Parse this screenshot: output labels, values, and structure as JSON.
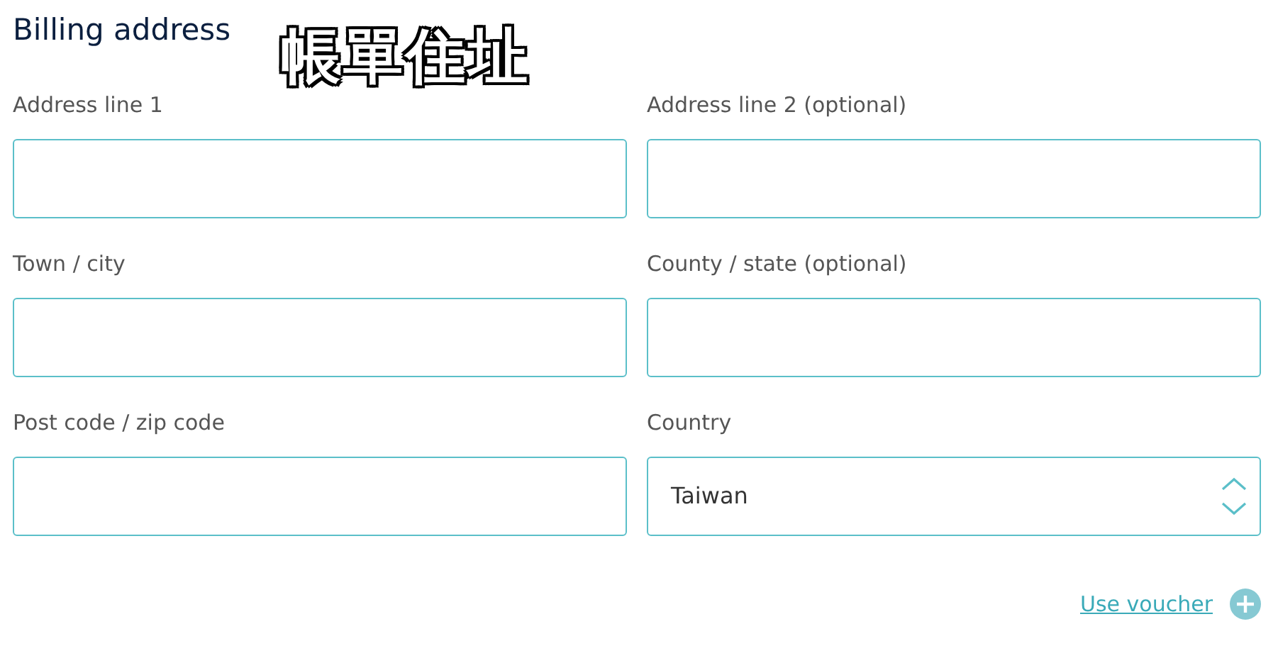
{
  "heading": "Billing address",
  "annotation": "帳單住址",
  "fields": [
    {
      "kind": "text",
      "label": "Address line 1"
    },
    {
      "kind": "text",
      "label": "Address line 2 (optional)"
    },
    {
      "kind": "text",
      "label": "Town / city"
    },
    {
      "kind": "text",
      "label": "County / state (optional)"
    },
    {
      "kind": "text",
      "label": "Post code / zip code"
    },
    {
      "kind": "select",
      "label": "Country",
      "value": "Taiwan"
    }
  ],
  "voucher_link": "Use voucher"
}
